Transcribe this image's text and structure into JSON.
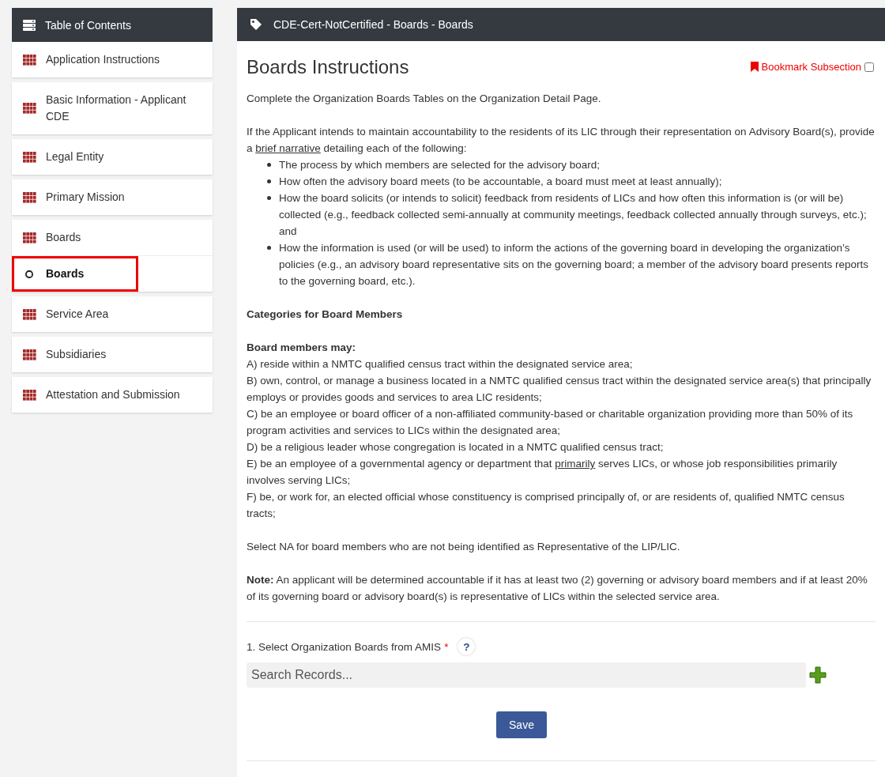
{
  "sidebar": {
    "title": "Table of Contents",
    "items": [
      {
        "label": "Application Instructions",
        "kind": "section",
        "selected": false
      },
      {
        "label": "Basic Information - Applicant CDE",
        "kind": "section",
        "selected": false
      },
      {
        "label": "Legal Entity",
        "kind": "section",
        "selected": false
      },
      {
        "label": "Primary Mission",
        "kind": "section",
        "selected": false
      },
      {
        "label": "Boards",
        "kind": "section",
        "selected": false
      },
      {
        "label": "Boards",
        "kind": "subsection",
        "selected": true
      },
      {
        "label": "Service Area",
        "kind": "section",
        "selected": false
      },
      {
        "label": "Subsidiaries",
        "kind": "section",
        "selected": false
      },
      {
        "label": "Attestation and Submission",
        "kind": "section",
        "selected": false
      }
    ]
  },
  "header": {
    "title": "CDE-Cert-NotCertified - Boards - Boards"
  },
  "content": {
    "heading": "Boards Instructions",
    "bookmark": {
      "label": "Bookmark Subsection",
      "checked": false
    },
    "intro": "Complete the Organization Boards Tables on the Organization Detail Page.",
    "narrative": [
      {
        "text": "If the Applicant intends to maintain accountability to the residents of its LIC through their representation on Advisory Board(s), provide a ",
        "underline": false
      },
      {
        "text": "brief narrative",
        "underline": true
      },
      {
        "text": " detailing each of the following:",
        "underline": false
      }
    ],
    "bullets": [
      "The process by which members are selected for the advisory board;",
      "How often the advisory board meets (to be accountable, a board must meet at least annually);",
      "How the board solicits (or intends to solicit) feedback from residents of LICs and how often this information is (or will be) collected (e.g., feedback collected semi-annually at community meetings, feedback collected annually through surveys, etc.); and",
      "How the information is used (or will be used) to inform the actions of the governing board in developing the organization’s policies (e.g., an advisory board representative sits on the governing board; a member of the advisory board presents reports to the governing board, etc.)."
    ],
    "categories_heading": "Categories for Board Members",
    "members_heading": "Board members may:",
    "members": [
      [
        {
          "text": "A) reside within a NMTC qualified census tract within the designated service area;",
          "underline": false
        }
      ],
      [
        {
          "text": "B) own, control, or manage a business located in a NMTC qualified census tract within the designated service area(s) that principally employs or provides goods and services to area LIC residents;",
          "underline": false
        }
      ],
      [
        {
          "text": "C) be an employee or board officer of a non-affiliated community-based or charitable organization providing more than 50% of its program activities and services to LICs within the designated area;",
          "underline": false
        }
      ],
      [
        {
          "text": "D) be a religious leader whose congregation is located in a NMTC qualified census tract;",
          "underline": false
        }
      ],
      [
        {
          "text": "E) be an employee of a governmental agency or department that ",
          "underline": false
        },
        {
          "text": "primarily",
          "underline": true
        },
        {
          "text": " serves LICs, or whose job responsibilities primarily involves serving LICs;",
          "underline": false
        }
      ],
      [
        {
          "text": "F) be, or work for, an elected official whose constituency is comprised principally of, or are residents of, qualified NMTC census tracts;",
          "underline": false
        }
      ]
    ],
    "select_na": "Select NA for board members who are not being identified as Representative of the LIP/LIC.",
    "note": "**Note:** An applicant will be determined accountable if it has at least two (2) governing or advisory board members and if at least 20% of its governing board or advisory board(s) is representative of LICs within the selected service area.",
    "question": {
      "label": "1. Select Organization Boards from AMIS",
      "required_mark": "*",
      "help": "?"
    },
    "search": {
      "placeholder": "Search Records..."
    },
    "save": "Save"
  }
}
